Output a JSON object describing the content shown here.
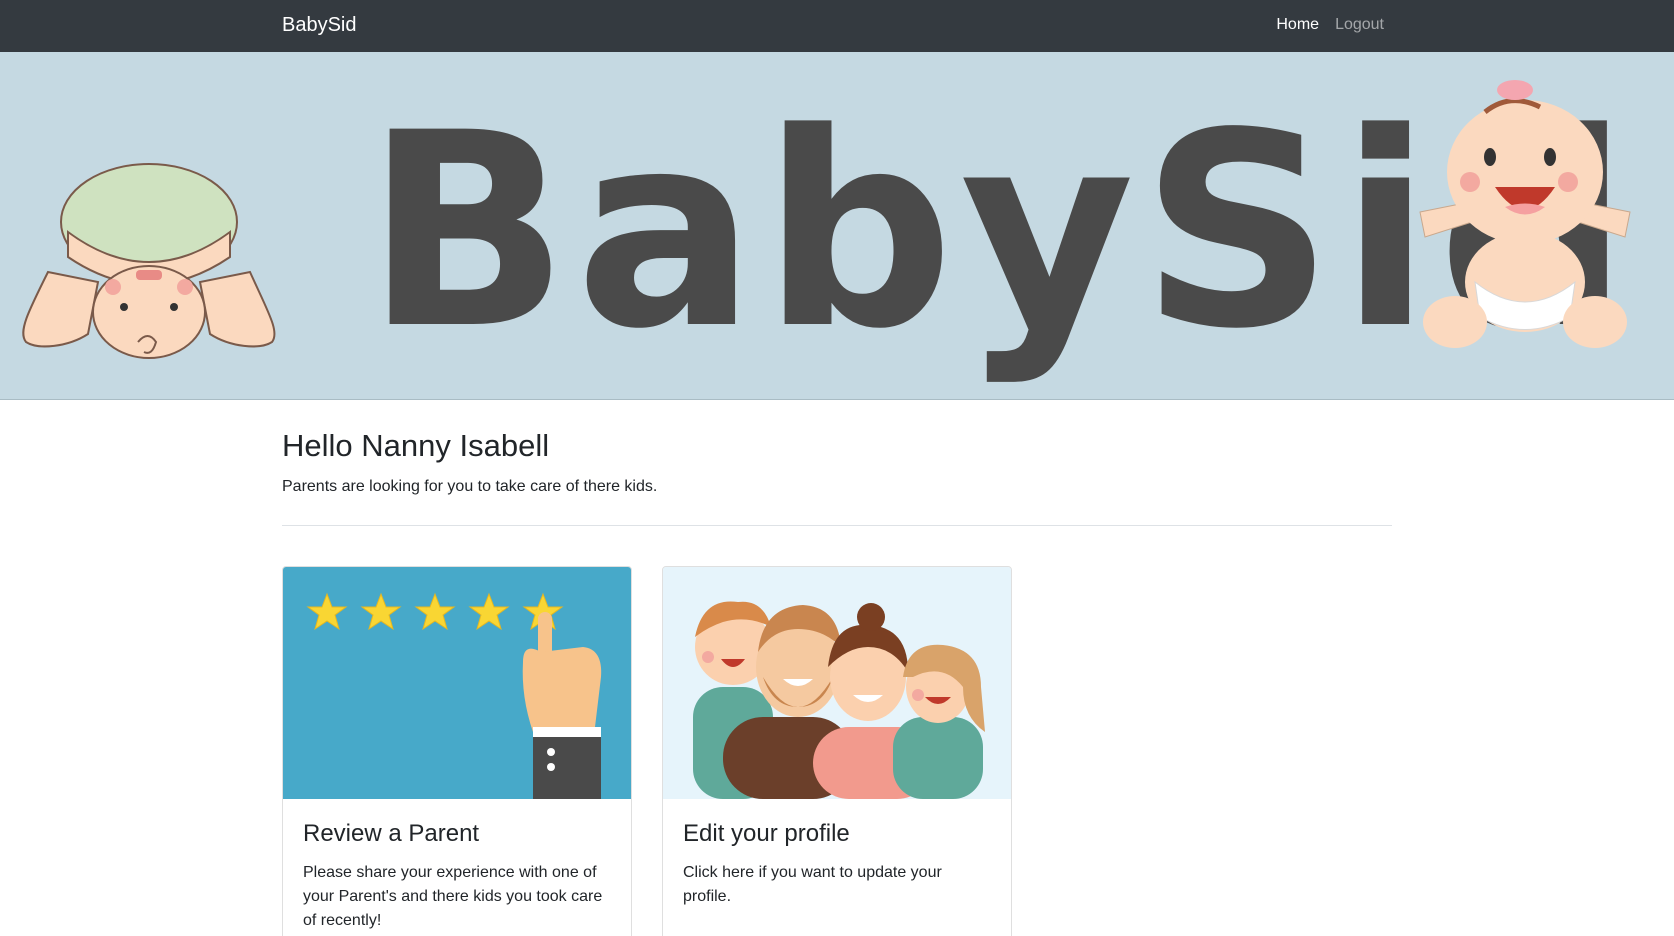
{
  "navbar": {
    "brand": "BabySid",
    "links": [
      {
        "label": "Home",
        "active": true
      },
      {
        "label": "Logout",
        "active": false
      }
    ]
  },
  "hero": {
    "title": "BabySid"
  },
  "main": {
    "greeting": "Hello Nanny Isabell",
    "subtitle": "Parents are looking for you to take care of there kids."
  },
  "cards": [
    {
      "title": "Review a Parent",
      "text": "Please share your experience with one of your Parent's and there kids you took care of recently!",
      "image": "five-stars-rating-illustration"
    },
    {
      "title": "Edit your profile",
      "text": "Click here if you want to update your profile.",
      "image": "happy-family-illustration"
    }
  ],
  "colors": {
    "navbar_bg": "#343a40",
    "hero_bg": "#c5d9e2",
    "rating_bg": "#47a9c9",
    "star": "#f9d633"
  }
}
